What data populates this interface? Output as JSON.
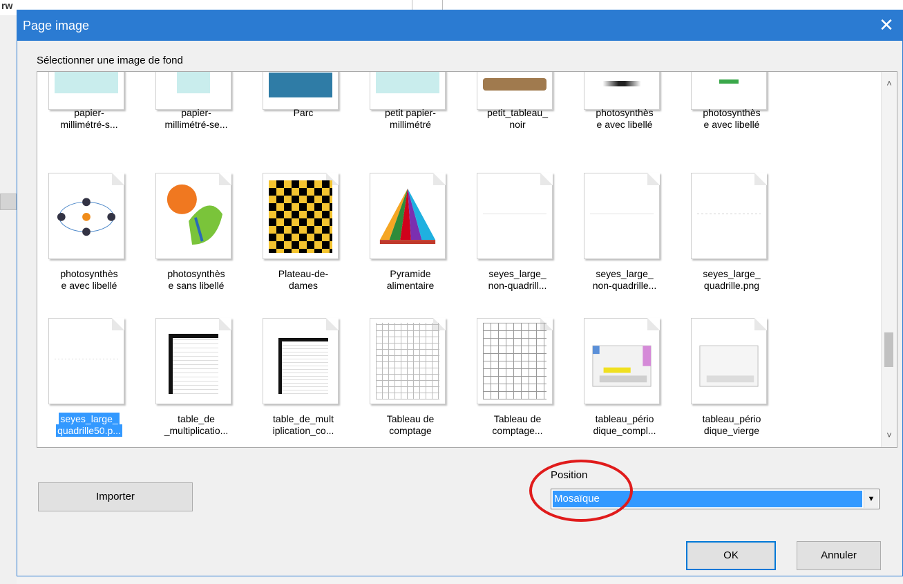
{
  "dialog": {
    "title": "Page image",
    "close_glyph": "✕",
    "select_label": "Sélectionner une image de fond"
  },
  "background": {
    "corner_text": "rw"
  },
  "gallery": {
    "row0": [
      "papier-millimétré-s...",
      "papier-millimétré-se...",
      "Parc",
      "petit papier-millimétré",
      "petit_tableau_noir",
      "photosynthèse avec libellé",
      "photosynthèse avec libellé"
    ],
    "row1": [
      "photosynthèse avec libellé",
      "photosynthèse sans libellé",
      "Plateau-de-dames",
      "Pyramide alimentaire",
      "seyes_large_non-quadrill...",
      "seyes_large_non-quadrille...",
      "seyes_large_quadrille.png"
    ],
    "row2": [
      "seyes_large_quadrille50.p...",
      "table_de_multiplicatio...",
      "table_de_multiplication_co...",
      "Tableau de comptage",
      "Tableau de comptage...",
      "tableau_périodique_compl...",
      "tableau_périodique_vierge"
    ],
    "captions_display": {
      "row0": [
        [
          "papier-",
          "millimétré-s..."
        ],
        [
          "papier-",
          "millimétré-se..."
        ],
        [
          "Parc",
          ""
        ],
        [
          "petit papier-",
          "millimétré"
        ],
        [
          "petit_tableau_",
          "noir"
        ],
        [
          "photosynthès",
          "e avec libellé"
        ],
        [
          "photosynthès",
          "e avec libellé"
        ]
      ],
      "row1": [
        [
          "photosynthès",
          "e avec libellé"
        ],
        [
          "photosynthès",
          "e sans libellé"
        ],
        [
          "Plateau-de-",
          "dames"
        ],
        [
          "Pyramide",
          "alimentaire"
        ],
        [
          "seyes_large_",
          "non-quadrill..."
        ],
        [
          "seyes_large_",
          "non-quadrille..."
        ],
        [
          "seyes_large_",
          "quadrille.png"
        ]
      ],
      "row2": [
        [
          "seyes_large_",
          "quadrille50.p..."
        ],
        [
          "table_de",
          "_multiplicatio..."
        ],
        [
          "table_de_mult",
          "iplication_co..."
        ],
        [
          "Tableau de",
          "comptage"
        ],
        [
          "Tableau de",
          "comptage..."
        ],
        [
          "tableau_pério",
          "dique_compl..."
        ],
        [
          "tableau_pério",
          "dique_vierge"
        ]
      ]
    },
    "selected": "seyes_large_quadrille50.p...",
    "scroll_up_glyph": "˄",
    "scroll_down_glyph": "˅"
  },
  "buttons": {
    "import": "Importer",
    "ok": "OK",
    "cancel": "Annuler"
  },
  "position": {
    "label": "Position",
    "selected": "Mosaïque",
    "arrow_glyph": "▼"
  },
  "colors": {
    "titlebar": "#2b7bd2",
    "selection": "#3399ff",
    "annotation": "#e01b1b"
  }
}
